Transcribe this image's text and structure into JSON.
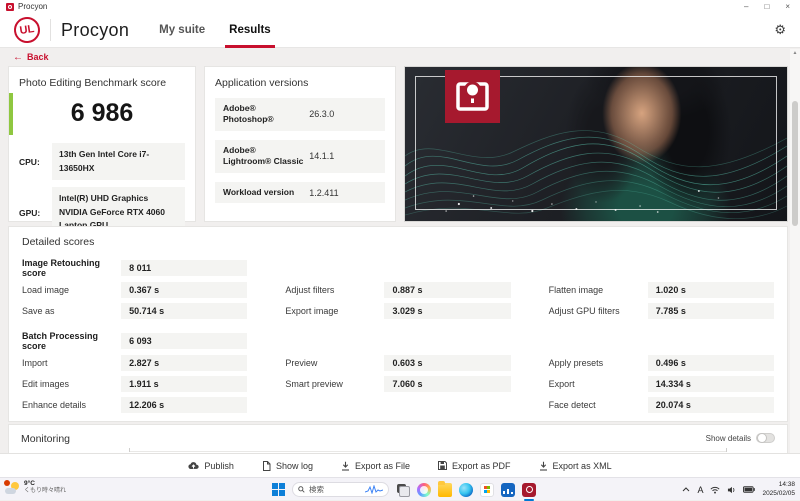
{
  "window": {
    "title": "Procyon",
    "minimize": "–",
    "maximize": "□",
    "close": "×"
  },
  "nav": {
    "logo": "UL",
    "brand": "Procyon",
    "tabs": [
      {
        "label": "My suite",
        "active": false
      },
      {
        "label": "Results",
        "active": true
      }
    ],
    "gear_glyph": "⚙"
  },
  "back": {
    "arrow": "←",
    "label": "Back"
  },
  "score_card": {
    "title": "Photo Editing Benchmark score",
    "score": "6 986",
    "cpu_label": "CPU:",
    "cpu_value": "13th Gen Intel Core i7-13650HX",
    "gpu_label": "GPU:",
    "gpu_value_1": "Intel(R) UHD Graphics",
    "gpu_value_2": "NVIDIA GeForce RTX 4060 Laptop GPU"
  },
  "app_versions": {
    "title": "Application versions",
    "rows": [
      {
        "label": "Adobe® Photoshop®",
        "value": "26.3.0"
      },
      {
        "label": "Adobe® Lightroom® Classic",
        "value": "14.1.1"
      },
      {
        "label": "Workload version",
        "value": "1.2.411"
      }
    ]
  },
  "detailed_scores": {
    "title": "Detailed scores",
    "groups": [
      {
        "rows": [
          [
            {
              "col": 0,
              "label": "Image Retouching score",
              "value": "8 011",
              "score": true
            }
          ],
          [
            {
              "col": 0,
              "label": "Load image",
              "value": "0.367 s"
            },
            {
              "col": 1,
              "label": "Adjust filters",
              "value": "0.887 s"
            },
            {
              "col": 2,
              "label": "Flatten image",
              "value": "1.020 s"
            }
          ],
          [
            {
              "col": 0,
              "label": "Save as",
              "value": "50.714 s"
            },
            {
              "col": 1,
              "label": "Export image",
              "value": "3.029 s"
            },
            {
              "col": 2,
              "label": "Adjust GPU filters",
              "value": "7.785 s"
            }
          ]
        ]
      },
      {
        "rows": [
          [
            {
              "col": 0,
              "label": "Batch Processing score",
              "value": "6 093",
              "score": true
            }
          ],
          [
            {
              "col": 0,
              "label": "Import",
              "value": "2.827 s"
            },
            {
              "col": 1,
              "label": "Preview",
              "value": "0.603 s"
            },
            {
              "col": 2,
              "label": "Apply presets",
              "value": "0.496 s"
            }
          ],
          [
            {
              "col": 0,
              "label": "Edit images",
              "value": "1.911 s"
            },
            {
              "col": 1,
              "label": "Smart preview",
              "value": "7.060 s"
            },
            {
              "col": 2,
              "label": "Export",
              "value": "14.334 s"
            }
          ],
          [
            {
              "col": 0,
              "label": "Enhance details",
              "value": "12.206 s"
            },
            {
              "col": 2,
              "label": "Face detect",
              "value": "20.074 s"
            }
          ]
        ]
      }
    ]
  },
  "monitoring": {
    "title": "Monitoring",
    "toggle_label": "Show details",
    "toggle_on": false
  },
  "actions": [
    {
      "id": "publish",
      "label": "Publish",
      "icon": "cloud-upload-icon"
    },
    {
      "id": "show-log",
      "label": "Show log",
      "icon": "document-icon"
    },
    {
      "id": "export-file",
      "label": "Export as File",
      "icon": "download-icon"
    },
    {
      "id": "export-pdf",
      "label": "Export as PDF",
      "icon": "save-icon"
    },
    {
      "id": "export-xml",
      "label": "Export as XML",
      "icon": "download-icon"
    }
  ],
  "taskbar": {
    "weather": {
      "temp": "9°C",
      "condition": "くもり時々晴れ"
    },
    "search": {
      "placeholder": "検索"
    },
    "apps": [
      {
        "id": "task-view",
        "name": "task-view-icon",
        "active": false
      },
      {
        "id": "copilot",
        "name": "copilot-icon",
        "active": false
      },
      {
        "id": "file-explorer",
        "name": "file-explorer-icon",
        "active": false
      },
      {
        "id": "edge",
        "name": "edge-icon",
        "active": false
      },
      {
        "id": "microsoft-store",
        "name": "microsoft-store-icon",
        "active": false
      },
      {
        "id": "monitoring-app",
        "name": "monitoring-app-icon",
        "active": false
      },
      {
        "id": "procyon",
        "name": "procyon-app-icon",
        "active": true
      }
    ],
    "tray": {
      "ime": "A",
      "time": "14:38",
      "date": "2025/02/05"
    }
  },
  "colors": {
    "brand_red": "#c8102e",
    "badge_red": "#a6192e",
    "score_green": "#8fc740",
    "taskbar_accent": "#0078d4"
  }
}
